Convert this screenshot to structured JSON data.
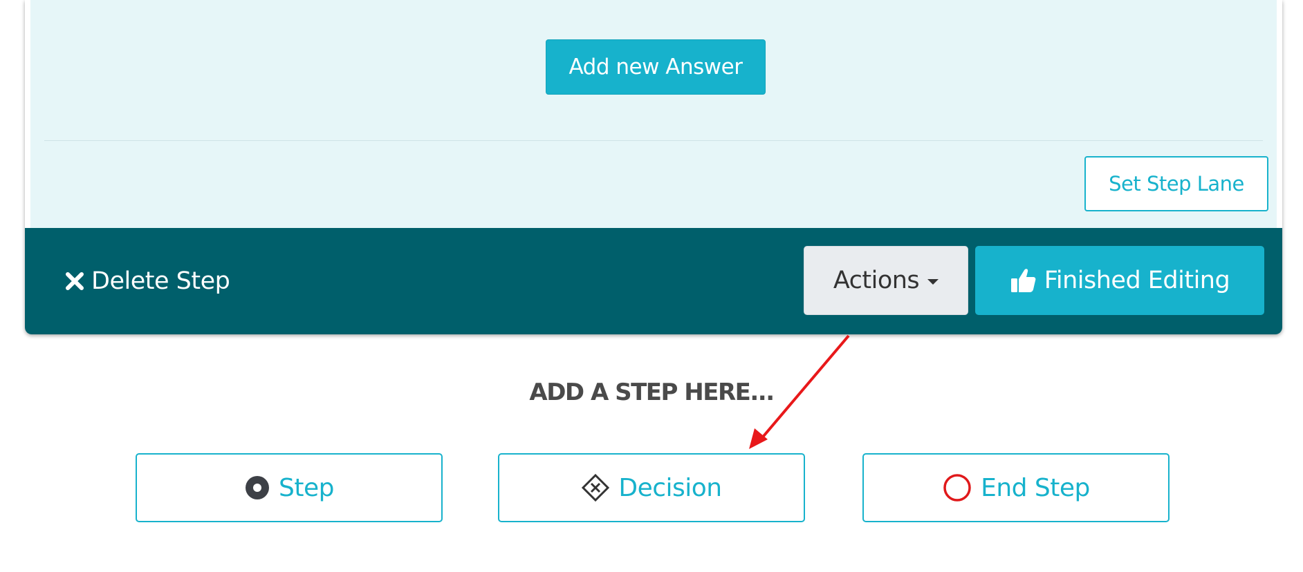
{
  "card": {
    "add_answer_label": "Add new Answer",
    "set_lane_label": "Set Step Lane"
  },
  "footer": {
    "delete_label": "Delete Step",
    "actions_label": "Actions",
    "finished_label": "Finished Editing"
  },
  "add_step": {
    "heading": "ADD A STEP HERE...",
    "options": [
      {
        "label": "Step",
        "icon": "filled-circle-icon"
      },
      {
        "label": "Decision",
        "icon": "diamond-x-icon"
      },
      {
        "label": "End Step",
        "icon": "red-circle-icon"
      }
    ]
  },
  "colors": {
    "primary": "#17b2cc",
    "footer": "#005f6b",
    "card_body": "#e6f6f8",
    "end_step": "#e0191b",
    "annotation_arrow": "#e8181a"
  }
}
